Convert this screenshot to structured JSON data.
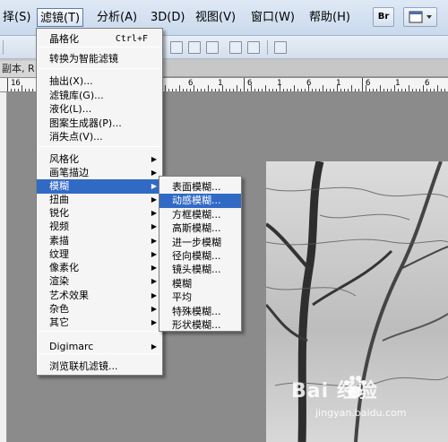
{
  "menubar": {
    "items": [
      {
        "label": "择(S)"
      },
      {
        "label": "滤镜(T)"
      },
      {
        "label": "分析(A)"
      },
      {
        "label": "3D(D)"
      },
      {
        "label": "视图(V)"
      },
      {
        "label": "窗口(W)"
      },
      {
        "label": "帮助(H)"
      }
    ],
    "bridge_button": "Br"
  },
  "document": {
    "tab_label": "副本, R"
  },
  "ruler": {
    "labels": [
      "16",
      "1",
      "6",
      "1",
      "6",
      "1",
      "6",
      "1",
      "6",
      "1",
      "6",
      "1",
      "6",
      "1",
      "6"
    ]
  },
  "filter_menu": {
    "items": [
      {
        "label": "晶格化",
        "shortcut": "Ctrl+F"
      },
      {
        "label": "转换为智能滤镜"
      },
      {
        "label": "抽出(X)..."
      },
      {
        "label": "滤镜库(G)..."
      },
      {
        "label": "液化(L)..."
      },
      {
        "label": "图案生成器(P)..."
      },
      {
        "label": "消失点(V)..."
      },
      {
        "label": "风格化",
        "submenu": true
      },
      {
        "label": "画笔描边",
        "submenu": true
      },
      {
        "label": "模糊",
        "submenu": true,
        "highlighted": true
      },
      {
        "label": "扭曲",
        "submenu": true
      },
      {
        "label": "锐化",
        "submenu": true
      },
      {
        "label": "视频",
        "submenu": true
      },
      {
        "label": "素描",
        "submenu": true
      },
      {
        "label": "纹理",
        "submenu": true
      },
      {
        "label": "像素化",
        "submenu": true
      },
      {
        "label": "渲染",
        "submenu": true
      },
      {
        "label": "艺术效果",
        "submenu": true
      },
      {
        "label": "杂色",
        "submenu": true
      },
      {
        "label": "其它",
        "submenu": true
      },
      {
        "label": "Digimarc",
        "submenu": true
      },
      {
        "label": "浏览联机滤镜..."
      }
    ],
    "arrow_glyph": "▶"
  },
  "blur_submenu": {
    "items": [
      {
        "label": "表面模糊..."
      },
      {
        "label": "动感模糊...",
        "highlighted": true
      },
      {
        "label": "方框模糊..."
      },
      {
        "label": "高斯模糊..."
      },
      {
        "label": "进一步模糊"
      },
      {
        "label": "径向模糊..."
      },
      {
        "label": "镜头模糊..."
      },
      {
        "label": "模糊"
      },
      {
        "label": "平均"
      },
      {
        "label": "特殊模糊..."
      },
      {
        "label": "形状模糊..."
      }
    ]
  },
  "watermark": {
    "brand": "Bai  经验",
    "url": "jingyan.baidu.com"
  }
}
